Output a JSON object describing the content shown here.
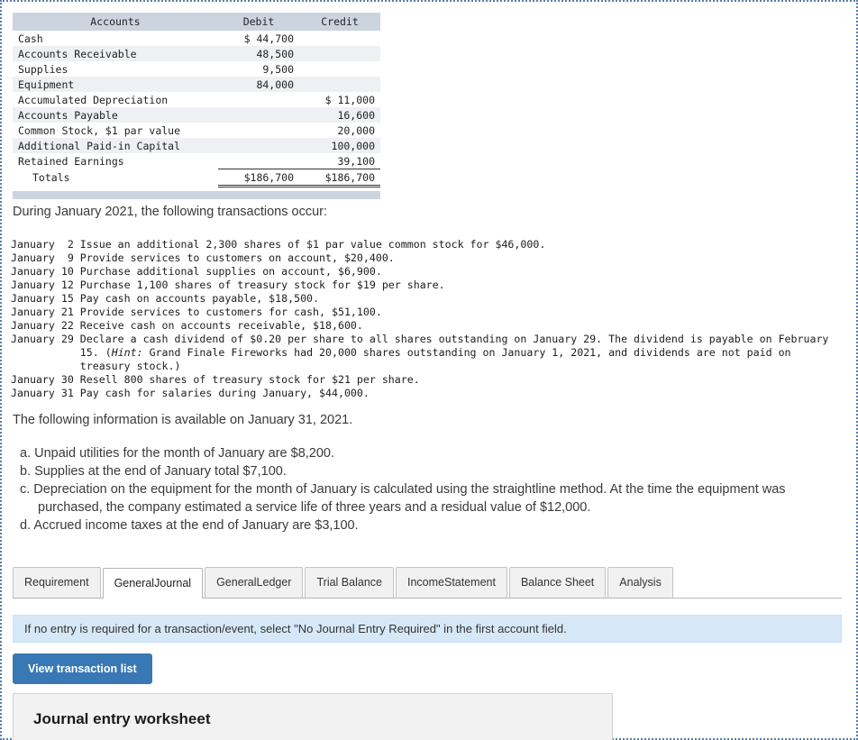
{
  "trial_balance": {
    "headers": {
      "accounts": "Accounts",
      "debit": "Debit",
      "credit": "Credit"
    },
    "rows": [
      {
        "account": "Cash",
        "debit": "$ 44,700",
        "credit": ""
      },
      {
        "account": "Accounts Receivable",
        "debit": "48,500",
        "credit": ""
      },
      {
        "account": "Supplies",
        "debit": "9,500",
        "credit": ""
      },
      {
        "account": "Equipment",
        "debit": "84,000",
        "credit": ""
      },
      {
        "account": "Accumulated Depreciation",
        "debit": "",
        "credit": "$ 11,000"
      },
      {
        "account": "Accounts Payable",
        "debit": "",
        "credit": "16,600"
      },
      {
        "account": "Common Stock, $1 par value",
        "debit": "",
        "credit": "20,000"
      },
      {
        "account": "Additional Paid-in Capital",
        "debit": "",
        "credit": "100,000"
      },
      {
        "account": "Retained Earnings",
        "debit": "",
        "credit": "39,100"
      }
    ],
    "totals": {
      "label": "Totals",
      "debit": "$186,700",
      "credit": "$186,700"
    }
  },
  "intro": "During January 2021, the following transactions occur:",
  "transactions": [
    "January  2 Issue an additional 2,300 shares of $1 par value common stock for $46,000.",
    "January  9 Provide services to customers on account, $20,400.",
    "January 10 Purchase additional supplies on account, $6,900.",
    "January 12 Purchase 1,100 shares of treasury stock for $19 per share.",
    "January 15 Pay cash on accounts payable, $18,500.",
    "January 21 Provide services to customers for cash, $51,100.",
    "January 22 Receive cash on accounts receivable, $18,600.",
    "January 29 Declare a cash dividend of $0.20 per share to all shares outstanding on January 29. The dividend is payable on February",
    "           15. (Hint: Grand Finale Fireworks had 20,000 shares outstanding on January 1, 2021, and dividends are not paid on",
    "           treasury stock.)",
    "January 30 Resell 800 shares of treasury stock for $21 per share.",
    "January 31 Pay cash for salaries during January, $44,000."
  ],
  "available_info_heading": "The following information is available on January 31, 2021.",
  "adjustments": [
    {
      "text": "a. Unpaid utilities for the month of January are $8,200.",
      "cont": ""
    },
    {
      "text": "b. Supplies at the end of January total $7,100.",
      "cont": ""
    },
    {
      "text": "c. Depreciation on the equipment for the month of January is calculated using the straightline method. At the time the equipment was",
      "cont": "purchased, the company estimated a service life of three years and a residual value of $12,000."
    },
    {
      "text": "d. Accrued income taxes at the end of January are $3,100.",
      "cont": ""
    }
  ],
  "tabs": [
    {
      "label": "Requirement",
      "active": false
    },
    {
      "label": "General\nJournal",
      "active": true
    },
    {
      "label": "General\nLedger",
      "active": false
    },
    {
      "label": "Trial Balance",
      "active": false
    },
    {
      "label": "Income\nStatement",
      "active": false
    },
    {
      "label": "Balance Sheet",
      "active": false
    },
    {
      "label": "Analysis",
      "active": false
    }
  ],
  "notice": "If no entry is required for a transaction/event, select \"No Journal Entry Required\" in the first account field.",
  "view_transactions_button": "View transaction list",
  "worksheet_title": "Journal entry worksheet",
  "colors": {
    "page_border": "#5a7da5",
    "table_header_bg": "#ccd4e0",
    "table_alt_row": "#eef0f4",
    "notice_bg": "#d6e8f7",
    "primary_button": "#3878b4",
    "tab_inactive_bg": "#f1f1f1",
    "worksheet_bg": "#f2f2f2"
  }
}
